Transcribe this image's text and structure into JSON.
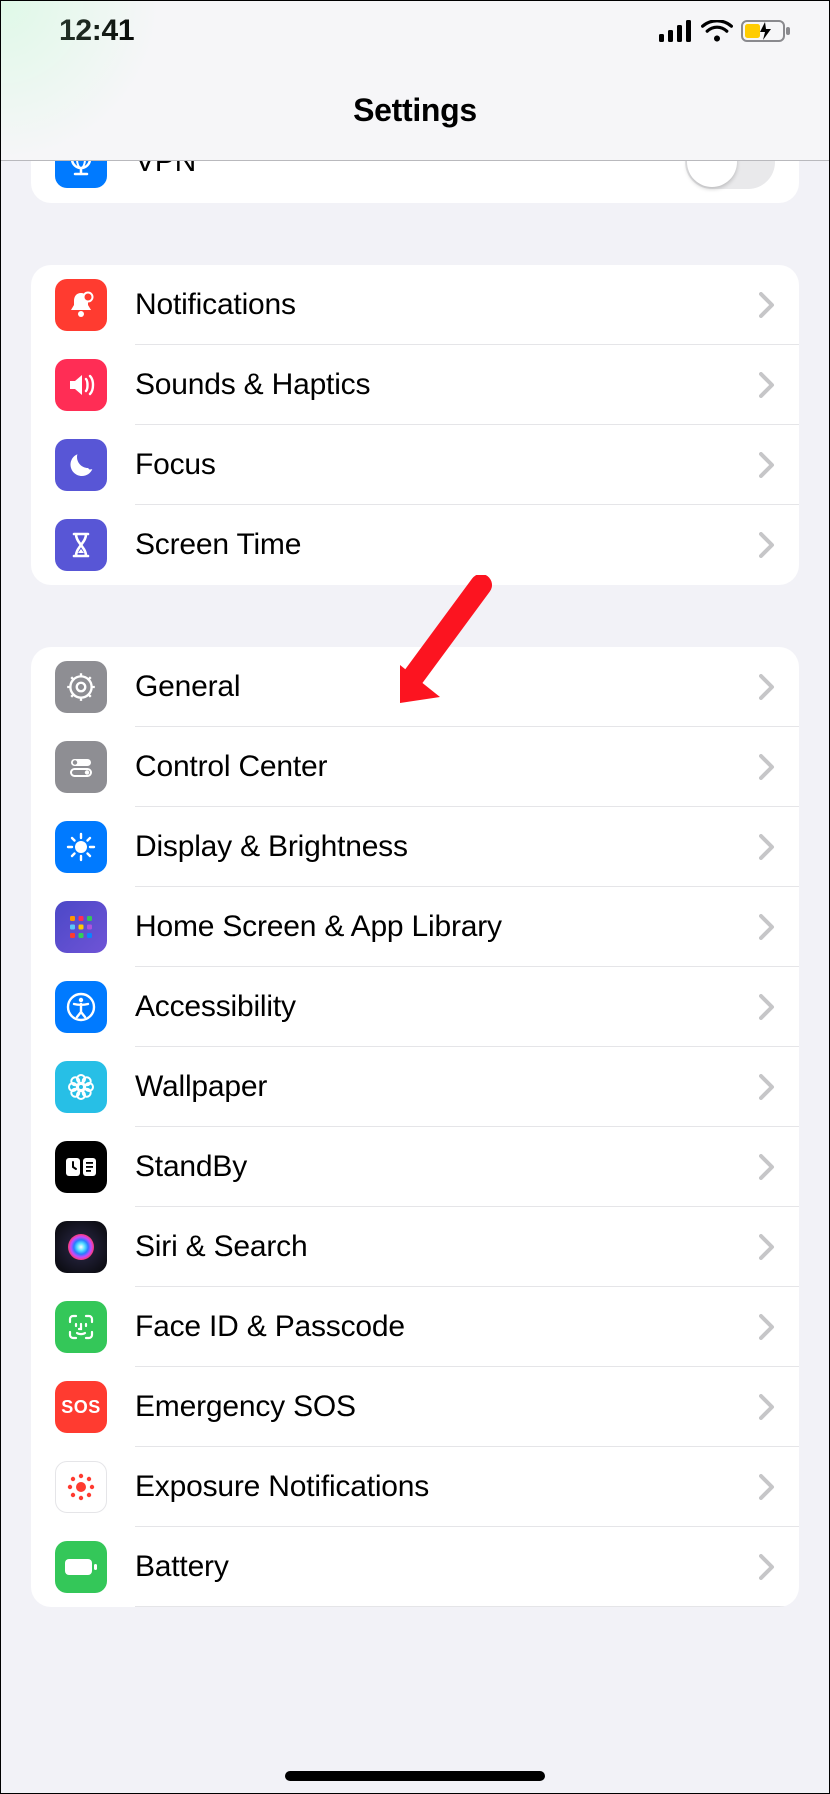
{
  "status": {
    "time": "12:41"
  },
  "nav": {
    "title": "Settings"
  },
  "group0": {
    "vpn": {
      "label": "VPN",
      "icon": "globe-icon",
      "color": "#007aff",
      "toggle": false
    }
  },
  "group1": {
    "items": [
      {
        "label": "Notifications",
        "icon": "bell-icon",
        "color": "#ff3b30"
      },
      {
        "label": "Sounds & Haptics",
        "icon": "speaker-icon",
        "color": "#ff2d55"
      },
      {
        "label": "Focus",
        "icon": "moon-icon",
        "color": "#5856d6"
      },
      {
        "label": "Screen Time",
        "icon": "hourglass-icon",
        "color": "#5856d6"
      }
    ]
  },
  "group2": {
    "items": [
      {
        "label": "General",
        "icon": "gear-icon",
        "color": "#8e8e93"
      },
      {
        "label": "Control Center",
        "icon": "switches-icon",
        "color": "#8e8e93"
      },
      {
        "label": "Display & Brightness",
        "icon": "sun-icon",
        "color": "#007aff"
      },
      {
        "label": "Home Screen & App Library",
        "icon": "apps-grid-icon",
        "color": "#5455c6"
      },
      {
        "label": "Accessibility",
        "icon": "accessibility-icon",
        "color": "#007aff"
      },
      {
        "label": "Wallpaper",
        "icon": "flower-icon",
        "color": "#27bfe6"
      },
      {
        "label": "StandBy",
        "icon": "standby-icon",
        "color": "#000000"
      },
      {
        "label": "Siri & Search",
        "icon": "siri-icon",
        "color": "#1a1a2a"
      },
      {
        "label": "Face ID & Passcode",
        "icon": "faceid-icon",
        "color": "#34c759"
      },
      {
        "label": "Emergency SOS",
        "icon": "sos-icon",
        "color": "#ff3b30"
      },
      {
        "label": "Exposure Notifications",
        "icon": "exposure-icon",
        "color": "#ffffff"
      },
      {
        "label": "Battery",
        "icon": "battery-icon",
        "color": "#34c759"
      }
    ]
  },
  "annotation": {
    "arrow_points_to": "General"
  }
}
